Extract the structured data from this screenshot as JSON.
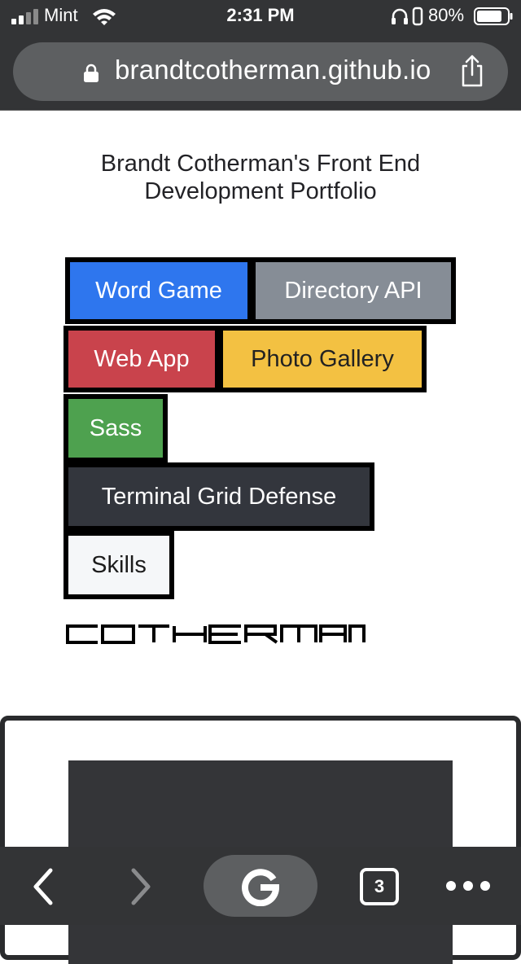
{
  "status_bar": {
    "carrier": "Mint",
    "time": "2:31 PM",
    "battery": "80%"
  },
  "browser": {
    "url": "brandtcotherman.github.io",
    "tab_count": "3"
  },
  "page": {
    "title": "Brandt Cotherman's Front End Development Portfolio",
    "nav_buttons": [
      {
        "label": "Word Game",
        "color": "#2e76ee"
      },
      {
        "label": "Directory API",
        "color": "#868d96"
      },
      {
        "label": "Web App",
        "color": "#c9434c"
      },
      {
        "label": "Photo Gallery",
        "color": "#f3c142"
      },
      {
        "label": "Sass",
        "color": "#4ea14f"
      },
      {
        "label": "Terminal Grid Defense",
        "color": "#33363d"
      },
      {
        "label": "Skills",
        "color": "#f5f7f9"
      }
    ],
    "logo_text": "COTHERMAN"
  },
  "icons": {
    "status": [
      "signal-icon",
      "wifi-icon",
      "headphones-icon",
      "orientation-lock-icon",
      "battery-icon"
    ],
    "address": [
      "lock-icon",
      "share-icon"
    ],
    "toolbar": [
      "back-icon",
      "forward-icon",
      "google-icon",
      "tabs-icon",
      "more-icon"
    ]
  }
}
